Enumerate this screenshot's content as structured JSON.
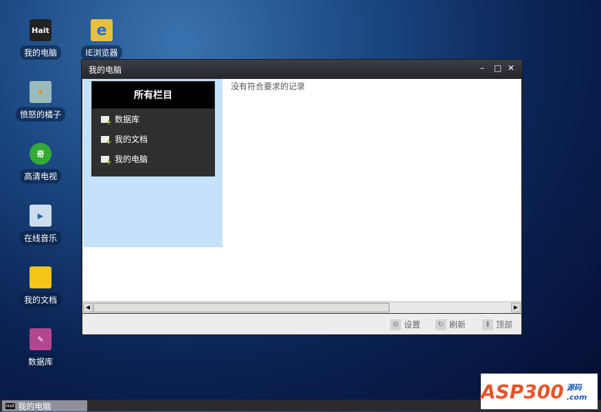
{
  "desktop_icons": [
    {
      "label": "我的电脑",
      "glyph": "Hait"
    },
    {
      "label": "IE浏览器",
      "glyph": "e"
    },
    {
      "label": "愤怒的橘子",
      "glyph": "✦"
    },
    {
      "label": "高清电视",
      "glyph": "奇"
    },
    {
      "label": "在线音乐",
      "glyph": "▶"
    },
    {
      "label": "我的文档",
      "glyph": "▬"
    },
    {
      "label": "数据库",
      "glyph": "✎"
    }
  ],
  "window": {
    "title": "我的电脑",
    "minimize": "–",
    "maximize": "□",
    "close": "✕",
    "panel_title": "所有栏目",
    "items": [
      "数据库",
      "我的文档",
      "我的电脑"
    ],
    "message": "没有符合要求的记录",
    "footer": {
      "settings": "设置",
      "refresh": "刷新",
      "top": "顶部"
    }
  },
  "taskbar": {
    "task_label": "我的电脑",
    "task_icon": "Hait"
  },
  "watermark": {
    "text": "ASP300",
    "sub": "源码 .com"
  }
}
